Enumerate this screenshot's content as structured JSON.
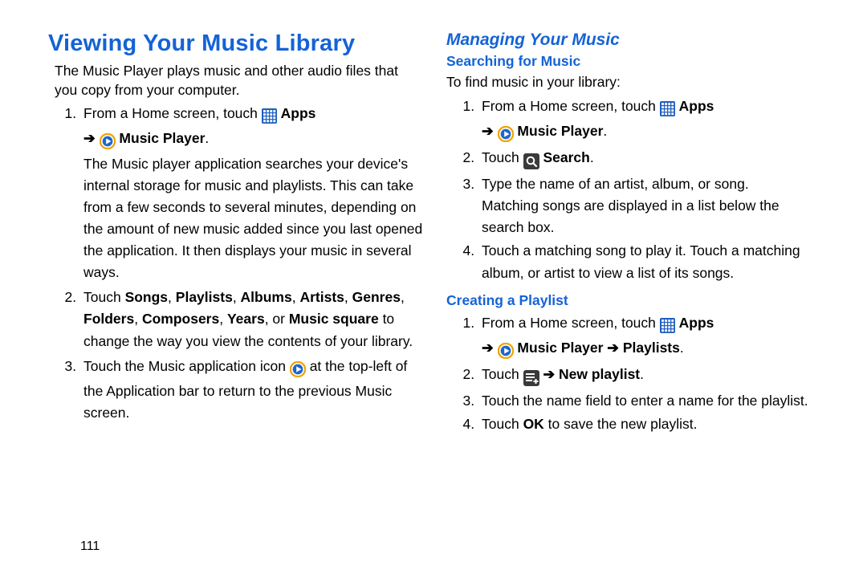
{
  "page_number": "111",
  "left": {
    "section_title": "Viewing Your Music Library",
    "intro": "The Music Player plays music and other audio files that you copy from your computer.",
    "li1_pre": "From a Home screen, touch ",
    "apps_label": "Apps",
    "arrow": "➔",
    "music_player_label": "Music Player",
    "li1_rest": "The Music player application searches your device's internal storage for music and playlists. This can take from a few seconds to several minutes, depending on the amount of new music added since you last opened the application. It then displays your music in several ways.",
    "li2_a": "Touch ",
    "li2_b1": "Songs",
    "li2_b2": "Playlists",
    "li2_b3": "Albums",
    "li2_b4": "Artists",
    "li2_b5": "Genres",
    "li2_b6": "Folders",
    "li2_b7": "Composers",
    "li2_b8": "Years",
    "li2_b9": "Music square",
    "li2_c": " to change the way you view the contents of your library.",
    "li3_a": "Touch the Music application icon ",
    "li3_b": " at the top-left of the Application bar to return to the previous Music screen."
  },
  "right": {
    "managing_title": "Managing Your Music",
    "search_title": "Searching for Music",
    "intro": "To find music in your library:",
    "s1_pre": "From a Home screen, touch ",
    "apps_label": "Apps",
    "arrow": "➔",
    "music_player_label": "Music Player",
    "s2_a": "Touch ",
    "s2_b": "Search",
    "s3_a": "Type the name of an artist, album, or song.",
    "s3_b": "Matching songs are displayed in a list below the search box.",
    "s4": "Touch a matching song to play it. Touch a matching album, or artist to view a list of its songs.",
    "create_title": "Creating a Playlist",
    "c1_pre": "From a Home screen, touch ",
    "c1_apps": "Apps",
    "c1_arrow": "➔",
    "c1_mp": "Music Player",
    "c1_arrow2": "➔",
    "c1_pl": "Playlists",
    "c2_a": "Touch ",
    "c2_arrow": "➔",
    "c2_b": "New playlist",
    "c3": "Touch the name field to enter a name for the playlist.",
    "c4_a": "Touch ",
    "c4_b": "OK",
    "c4_c": " to save the new playlist."
  }
}
